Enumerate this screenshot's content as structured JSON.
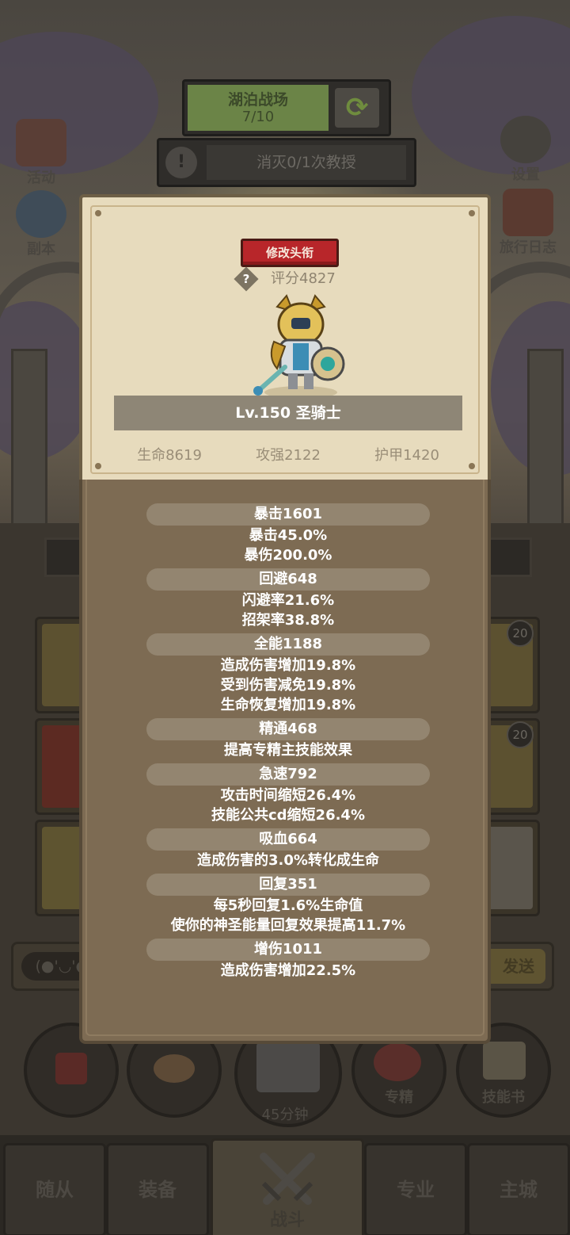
{
  "background": {
    "stage": {
      "name": "湖泊战场",
      "progress": "7/10"
    },
    "quest": {
      "text": "消灭0/1次教授"
    },
    "left_icons": [
      {
        "label": "活动"
      },
      {
        "label": "副本"
      }
    ],
    "right_icons": [
      {
        "label": "设置"
      },
      {
        "label": "旅行日志"
      }
    ],
    "card_badges": [
      "20",
      "20"
    ],
    "chat": {
      "emote": "(●'◡'●)",
      "send_label": "发送"
    },
    "actions": {
      "specialization": "专精",
      "skill_book": "技能书",
      "timer": "45分钟"
    },
    "nav": {
      "follower": "随从",
      "equipment": "装备",
      "battle": "战斗",
      "profession": "专业",
      "main_city": "主城"
    }
  },
  "popup": {
    "title_button": "修改头衔",
    "score": "评分4827",
    "hero_name": "Lv.150 圣骑士",
    "stats": {
      "hp": "生命8619",
      "attack": "攻强2122",
      "armor": "护甲1420"
    },
    "attributes": [
      {
        "header": "暴击1601",
        "details": [
          "暴击45.0%",
          "暴伤200.0%"
        ]
      },
      {
        "header": "回避648",
        "details": [
          "闪避率21.6%",
          "招架率38.8%"
        ]
      },
      {
        "header": "全能1188",
        "details": [
          "造成伤害增加19.8%",
          "受到伤害减免19.8%",
          "生命恢复增加19.8%"
        ]
      },
      {
        "header": "精通468",
        "details": [
          "提高专精主技能效果"
        ]
      },
      {
        "header": "急速792",
        "details": [
          "攻击时间缩短26.4%",
          "技能公共cd缩短26.4%"
        ]
      },
      {
        "header": "吸血664",
        "details": [
          "造成伤害的3.0%转化成生命"
        ]
      },
      {
        "header": "回复351",
        "details": [
          "每5秒回复1.6%生命值",
          "使你的神圣能量回复效果提高11.7%"
        ]
      },
      {
        "header": "增伤1011",
        "details": [
          "造成伤害增加22.5%"
        ]
      }
    ]
  },
  "colors": {
    "title_button": "#b8262a",
    "popup_parchment": "#e7dbbd",
    "popup_body": "#7d6b53",
    "attr_pill": "#938570"
  }
}
